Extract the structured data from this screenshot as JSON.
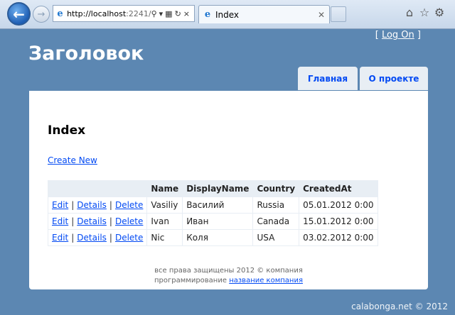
{
  "browser": {
    "url_host": "http://localhost",
    "url_rest": ":2241/",
    "tab_title": "Index"
  },
  "header": {
    "login_open": "[ ",
    "login_label": "Log On",
    "login_close": " ]",
    "site_title": "Заголовок",
    "menu": {
      "home": "Главная",
      "about": "О проекте"
    }
  },
  "main": {
    "heading": "Index",
    "create_link": "Create New",
    "columns": [
      "",
      "Name",
      "DisplayName",
      "Country",
      "CreatedAt"
    ],
    "actions": {
      "edit": "Edit",
      "details": "Details",
      "delete": "Delete",
      "separator": "|"
    },
    "rows": [
      {
        "name": "Vasiliy",
        "display_name": "Василий",
        "country": "Russia",
        "created_at": "05.01.2012 0:00"
      },
      {
        "name": "Ivan",
        "display_name": "Иван",
        "country": "Canada",
        "created_at": "15.01.2012 0:00"
      },
      {
        "name": "Nic",
        "display_name": "Коля",
        "country": "USA",
        "created_at": "03.02.2012 0:00"
      }
    ]
  },
  "footer": {
    "line1": "все права защищены 2012 © компания",
    "line2_prefix": "программирование ",
    "line2_link": "название компания"
  },
  "watermark": "calabonga.net © 2012",
  "icons": {
    "back": "back-arrow-icon",
    "forward": "forward-arrow-icon",
    "ie": "ie-logo-icon",
    "home": "home-icon",
    "favorites": "star-icon",
    "tools": "gear-icon"
  },
  "colors": {
    "page_bg": "#5c87b2",
    "content_bg": "#ffffff",
    "menu_bg": "#e8eef4",
    "link": "#034af3"
  }
}
